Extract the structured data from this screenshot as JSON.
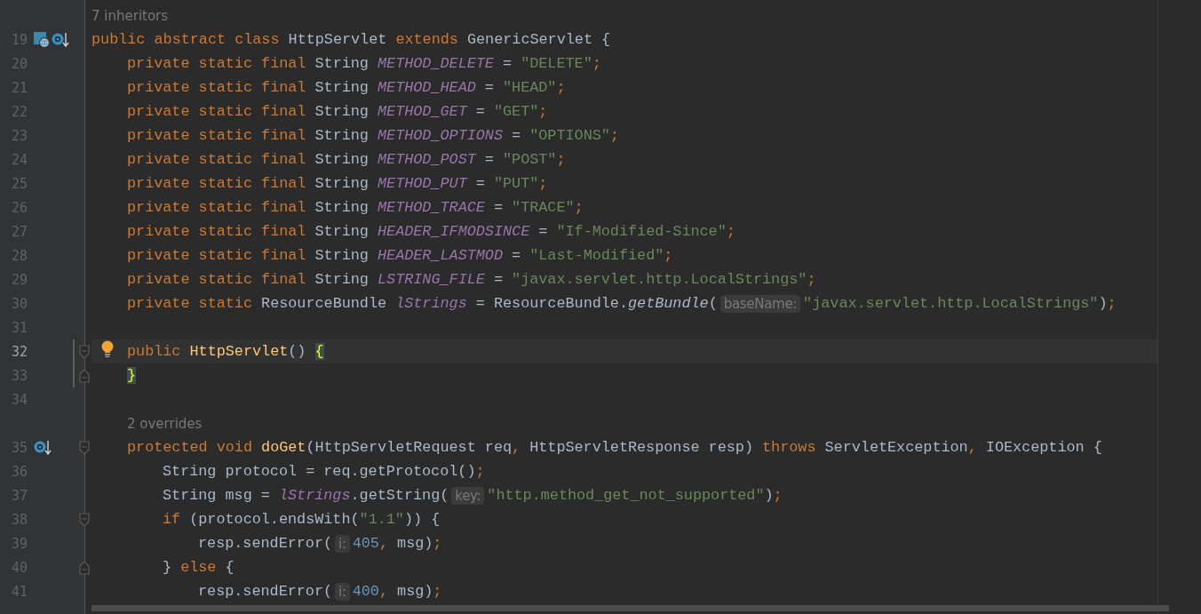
{
  "editor": {
    "rows": [
      {
        "kind": "lens",
        "text": "7 inheritors"
      },
      {
        "kind": "code",
        "number": "19",
        "current": false,
        "changed": false,
        "gutter_icons": [
          {
            "kind": "class"
          },
          {
            "kind": "overridden"
          }
        ],
        "tokens": [
          {
            "kind": "kw",
            "text": "public abstract class"
          },
          {
            "kind": "plain",
            "text": " HttpServlet "
          },
          {
            "kind": "kw",
            "text": "extends"
          },
          {
            "kind": "plain",
            "text": " GenericServlet {"
          }
        ],
        "children": [
          {
            "kind": "code",
            "number": "20",
            "current": false,
            "changed": false,
            "tokens": [
              {
                "kind": "kw",
                "text": "private static final"
              },
              {
                "kind": "plain",
                "text": " String "
              },
              {
                "kind": "field",
                "text": "METHOD_DELETE"
              },
              {
                "kind": "plain",
                "text": " = "
              },
              {
                "kind": "str",
                "text": "\"DELETE\""
              },
              {
                "kind": "kw",
                "text": ";"
              }
            ]
          },
          {
            "kind": "code",
            "number": "21",
            "current": false,
            "changed": false,
            "tokens": [
              {
                "kind": "kw",
                "text": "private static final"
              },
              {
                "kind": "plain",
                "text": " String "
              },
              {
                "kind": "field",
                "text": "METHOD_HEAD"
              },
              {
                "kind": "plain",
                "text": " = "
              },
              {
                "kind": "str",
                "text": "\"HEAD\""
              },
              {
                "kind": "kw",
                "text": ";"
              }
            ]
          },
          {
            "kind": "code",
            "number": "22",
            "current": false,
            "changed": false,
            "tokens": [
              {
                "kind": "kw",
                "text": "private static final"
              },
              {
                "kind": "plain",
                "text": " String "
              },
              {
                "kind": "field",
                "text": "METHOD_GET"
              },
              {
                "kind": "plain",
                "text": " = "
              },
              {
                "kind": "str",
                "text": "\"GET\""
              },
              {
                "kind": "kw",
                "text": ";"
              }
            ]
          },
          {
            "kind": "code",
            "number": "23",
            "current": false,
            "changed": false,
            "tokens": [
              {
                "kind": "kw",
                "text": "private static final"
              },
              {
                "kind": "plain",
                "text": " String "
              },
              {
                "kind": "field",
                "text": "METHOD_OPTIONS"
              },
              {
                "kind": "plain",
                "text": " = "
              },
              {
                "kind": "str",
                "text": "\"OPTIONS\""
              },
              {
                "kind": "kw",
                "text": ";"
              }
            ]
          },
          {
            "kind": "code",
            "number": "24",
            "current": false,
            "changed": false,
            "tokens": [
              {
                "kind": "kw",
                "text": "private static final"
              },
              {
                "kind": "plain",
                "text": " String "
              },
              {
                "kind": "field",
                "text": "METHOD_POST"
              },
              {
                "kind": "plain",
                "text": " = "
              },
              {
                "kind": "str",
                "text": "\"POST\""
              },
              {
                "kind": "kw",
                "text": ";"
              }
            ]
          },
          {
            "kind": "code",
            "number": "25",
            "current": false,
            "changed": false,
            "tokens": [
              {
                "kind": "kw",
                "text": "private static final"
              },
              {
                "kind": "plain",
                "text": " String "
              },
              {
                "kind": "field",
                "text": "METHOD_PUT"
              },
              {
                "kind": "plain",
                "text": " = "
              },
              {
                "kind": "str",
                "text": "\"PUT\""
              },
              {
                "kind": "kw",
                "text": ";"
              }
            ]
          },
          {
            "kind": "code",
            "number": "26",
            "current": false,
            "changed": false,
            "tokens": [
              {
                "kind": "kw",
                "text": "private static final"
              },
              {
                "kind": "plain",
                "text": " String "
              },
              {
                "kind": "field",
                "text": "METHOD_TRACE"
              },
              {
                "kind": "plain",
                "text": " = "
              },
              {
                "kind": "str",
                "text": "\"TRACE\""
              },
              {
                "kind": "kw",
                "text": ";"
              }
            ]
          },
          {
            "kind": "code",
            "number": "27",
            "current": false,
            "changed": false,
            "tokens": [
              {
                "kind": "kw",
                "text": "private static final"
              },
              {
                "kind": "plain",
                "text": " String "
              },
              {
                "kind": "field",
                "text": "HEADER_IFMODSINCE"
              },
              {
                "kind": "plain",
                "text": " = "
              },
              {
                "kind": "str",
                "text": "\"If-Modified-Since\""
              },
              {
                "kind": "kw",
                "text": ";"
              }
            ]
          },
          {
            "kind": "code",
            "number": "28",
            "current": false,
            "changed": false,
            "tokens": [
              {
                "kind": "kw",
                "text": "private static final"
              },
              {
                "kind": "plain",
                "text": " String "
              },
              {
                "kind": "field",
                "text": "HEADER_LASTMOD"
              },
              {
                "kind": "plain",
                "text": " = "
              },
              {
                "kind": "str",
                "text": "\"Last-Modified\""
              },
              {
                "kind": "kw",
                "text": ";"
              }
            ]
          },
          {
            "kind": "code",
            "number": "29",
            "current": false,
            "changed": false,
            "tokens": [
              {
                "kind": "kw",
                "text": "private static final"
              },
              {
                "kind": "plain",
                "text": " String "
              },
              {
                "kind": "field",
                "text": "LSTRING_FILE"
              },
              {
                "kind": "plain",
                "text": " = "
              },
              {
                "kind": "str",
                "text": "\"javax.servlet.http.LocalStrings\""
              },
              {
                "kind": "kw",
                "text": ";"
              }
            ]
          },
          {
            "kind": "code",
            "number": "30",
            "current": false,
            "changed": false,
            "tokens": [
              {
                "kind": "kw",
                "text": "private static"
              },
              {
                "kind": "plain",
                "text": " ResourceBundle "
              },
              {
                "kind": "field",
                "text": "lStrings"
              },
              {
                "kind": "plain",
                "text": " = ResourceBundle."
              },
              {
                "kind": "static",
                "text": "getBundle"
              },
              {
                "kind": "plain",
                "text": "("
              },
              {
                "kind": "hint",
                "text": "baseName:"
              },
              {
                "kind": "str",
                "text": "\"javax.servlet.http.LocalStrings\""
              },
              {
                "kind": "plain",
                "text": ")"
              },
              {
                "kind": "kw",
                "text": ";"
              }
            ]
          },
          {
            "kind": "code",
            "number": "31",
            "current": false,
            "changed": false
          },
          {
            "kind": "code",
            "number": "32",
            "current": true,
            "changed": true,
            "fold": {
              "kind": "start"
            },
            "bulb": true,
            "tokens": [
              {
                "kind": "kw",
                "text": "public "
              },
              {
                "kind": "method",
                "text": "HttpServlet"
              },
              {
                "kind": "plain",
                "text": "() "
              },
              {
                "kind": "brace",
                "text": "{"
              }
            ]
          },
          {
            "kind": "code",
            "number": "33",
            "current": false,
            "changed": true,
            "fold": {
              "kind": "end"
            },
            "tokens": [
              {
                "kind": "brace",
                "text": "}"
              }
            ]
          },
          {
            "kind": "code",
            "number": "34",
            "current": false,
            "changed": false
          },
          {
            "kind": "lens",
            "text": "2 overrides"
          },
          {
            "kind": "code",
            "number": "35",
            "current": false,
            "changed": false,
            "gutter_icons": [
              {
                "kind": "overridden"
              }
            ],
            "fold": {
              "kind": "start"
            },
            "tokens": [
              {
                "kind": "kw",
                "text": "protected void "
              },
              {
                "kind": "method",
                "text": "doGet"
              },
              {
                "kind": "plain",
                "text": "(HttpServletRequest req"
              },
              {
                "kind": "kw",
                "text": ","
              },
              {
                "kind": "plain",
                "text": " HttpServletResponse resp) "
              },
              {
                "kind": "kw",
                "text": "throws"
              },
              {
                "kind": "plain",
                "text": " ServletException"
              },
              {
                "kind": "kw",
                "text": ","
              },
              {
                "kind": "plain",
                "text": " IOException {"
              }
            ],
            "children": [
              {
                "kind": "code",
                "number": "36",
                "current": false,
                "changed": false,
                "tokens": [
                  {
                    "kind": "plain",
                    "text": "String protocol = req.getProtocol()"
                  },
                  {
                    "kind": "kw",
                    "text": ";"
                  }
                ]
              },
              {
                "kind": "code",
                "number": "37",
                "current": false,
                "changed": false,
                "tokens": [
                  {
                    "kind": "plain",
                    "text": "String msg = "
                  },
                  {
                    "kind": "field",
                    "text": "lStrings"
                  },
                  {
                    "kind": "plain",
                    "text": ".getString("
                  },
                  {
                    "kind": "hint",
                    "text": "key:"
                  },
                  {
                    "kind": "str",
                    "text": "\"http.method_get_not_supported\""
                  },
                  {
                    "kind": "plain",
                    "text": ")"
                  },
                  {
                    "kind": "kw",
                    "text": ";"
                  }
                ]
              },
              {
                "kind": "code",
                "number": "38",
                "current": false,
                "changed": false,
                "fold": {
                  "kind": "start"
                },
                "tokens": [
                  {
                    "kind": "kw",
                    "text": "if"
                  },
                  {
                    "kind": "plain",
                    "text": " (protocol.endsWith("
                  },
                  {
                    "kind": "str",
                    "text": "\"1.1\""
                  },
                  {
                    "kind": "plain",
                    "text": ")) {"
                  }
                ],
                "children": [
                  {
                    "kind": "code",
                    "number": "39",
                    "current": false,
                    "changed": false,
                    "tokens": [
                      {
                        "kind": "plain",
                        "text": "resp.sendError("
                      },
                      {
                        "kind": "hint",
                        "text": "i:"
                      },
                      {
                        "kind": "num",
                        "text": "405"
                      },
                      {
                        "kind": "kw",
                        "text": ","
                      },
                      {
                        "kind": "plain",
                        "text": " msg)"
                      },
                      {
                        "kind": "kw",
                        "text": ";"
                      }
                    ]
                  }
                ]
              },
              {
                "kind": "code",
                "number": "40",
                "current": false,
                "changed": false,
                "fold": {
                  "kind": "end"
                },
                "tokens": [
                  {
                    "kind": "plain",
                    "text": "} "
                  },
                  {
                    "kind": "kw",
                    "text": "else"
                  },
                  {
                    "kind": "plain",
                    "text": " {"
                  }
                ],
                "children": [
                  {
                    "kind": "code",
                    "number": "41",
                    "current": false,
                    "changed": false,
                    "tokens": [
                      {
                        "kind": "plain",
                        "text": "resp.sendError("
                      },
                      {
                        "kind": "hint",
                        "text": "i:"
                      },
                      {
                        "kind": "num",
                        "text": "400"
                      },
                      {
                        "kind": "kw",
                        "text": ","
                      },
                      {
                        "kind": "plain",
                        "text": " msg)"
                      },
                      {
                        "kind": "kw",
                        "text": ";"
                      }
                    ]
                  }
                ]
              }
            ]
          }
        ]
      }
    ]
  }
}
